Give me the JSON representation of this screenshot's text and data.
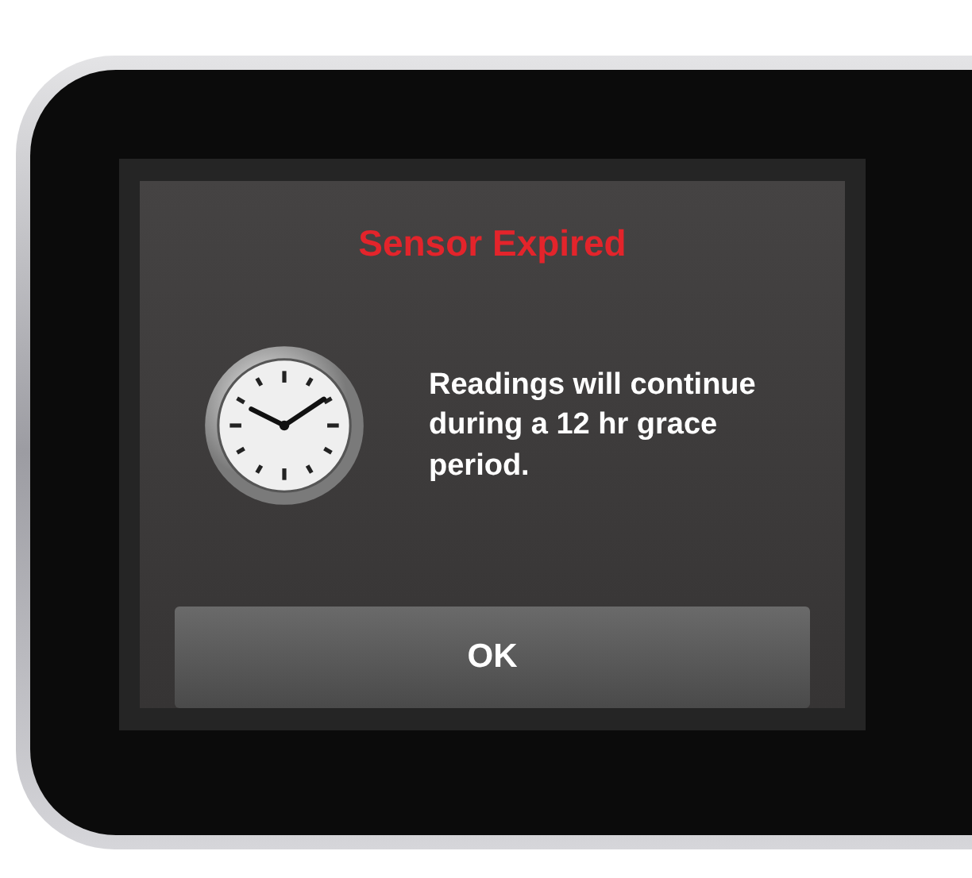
{
  "dialog": {
    "title": "Sensor Expired",
    "message": "Readings will continue during a 12 hr grace period.",
    "button": "OK"
  }
}
